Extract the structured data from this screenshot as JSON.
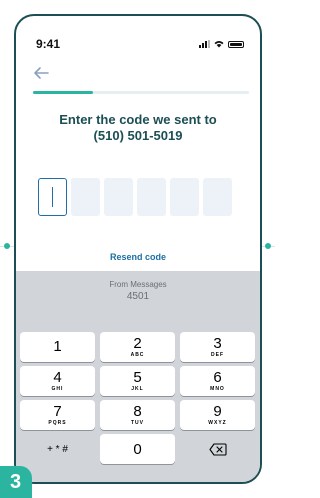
{
  "status": {
    "time": "9:41"
  },
  "header": {
    "title_line1": "Enter the code we sent to",
    "title_line2": "(510) 501-5019",
    "progress": 0.28
  },
  "code_input": {
    "digits": [
      "",
      "",
      "",
      "",
      "",
      ""
    ]
  },
  "resend_label": "Resend code",
  "keyboard": {
    "suggestion_from": "From Messages",
    "suggestion_code": "4501",
    "rows": [
      [
        {
          "digit": "1",
          "letters": ""
        },
        {
          "digit": "2",
          "letters": "ABC"
        },
        {
          "digit": "3",
          "letters": "DEF"
        }
      ],
      [
        {
          "digit": "4",
          "letters": "GHI"
        },
        {
          "digit": "5",
          "letters": "JKL"
        },
        {
          "digit": "6",
          "letters": "MNO"
        }
      ],
      [
        {
          "digit": "7",
          "letters": "PQRS"
        },
        {
          "digit": "8",
          "letters": "TUV"
        },
        {
          "digit": "9",
          "letters": "WXYZ"
        }
      ]
    ],
    "symbols_label": "+ * #",
    "zero": "0",
    "delete_icon": "backspace-icon"
  },
  "step_badge": "3",
  "colors": {
    "brand": "#1c4f54",
    "accent": "#2bb5a0",
    "link": "#1d6fa5"
  }
}
